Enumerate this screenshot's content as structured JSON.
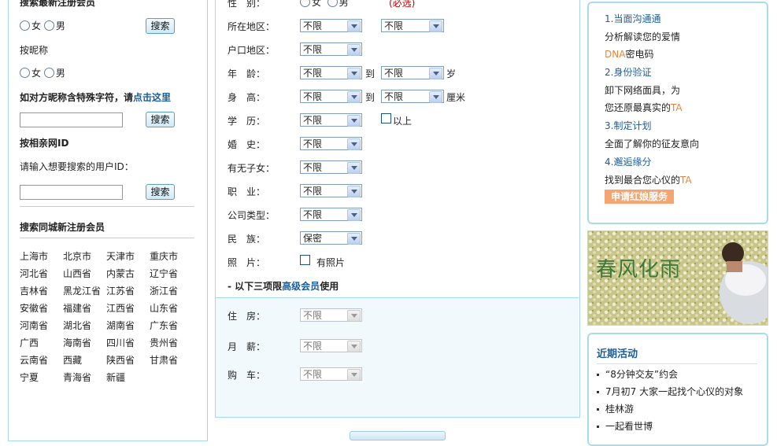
{
  "left": {
    "title_newest": "搜索最新注册会员",
    "female": "女",
    "male": "男",
    "search_btn": "搜索",
    "by_nickname": "按昵称",
    "special_prefix": "如对方昵称含特殊字符，请",
    "special_link": "点击这里",
    "by_id_title": "按相亲网ID",
    "id_prompt": "请输入想要搜索的用户ID：",
    "city_title": "搜索同城新注册会员",
    "cities": [
      "上海市",
      "北京市",
      "天津市",
      "重庆市",
      "河北省",
      "山西省",
      "内蒙古",
      "辽宁省",
      "吉林省",
      "黑龙江省",
      "江苏省",
      "浙江省",
      "安徽省",
      "福建省",
      "江西省",
      "山东省",
      "河南省",
      "湖北省",
      "湖南省",
      "广东省",
      "广西",
      "海南省",
      "四川省",
      "贵州省",
      "云南省",
      "西藏",
      "陕西省",
      "甘肃省",
      "宁夏",
      "青海省",
      "新疆"
    ]
  },
  "form": {
    "gender_label": "性　别：",
    "female": "女",
    "male": "男",
    "required": "(必选)",
    "region_label": "所在地区：",
    "hukou_label": "户口地区：",
    "age_label": "年　龄：",
    "height_label": "身　高：",
    "edu_label": "学　历：",
    "marriage_label": "婚　史：",
    "children_label": "有无子女：",
    "job_label": "职　业：",
    "company_label": "公司类型：",
    "nation_label": "民　族：",
    "photo_label": "照　片：",
    "to": "到",
    "age_unit": "岁",
    "height_unit": "厘米",
    "above": "以上",
    "has_photo": "有照片",
    "unlimited": "不限",
    "secret": "保密",
    "premium_prefix": "- 以下三项限",
    "premium_link": "高级会员",
    "premium_suffix": "使用",
    "housing_label": "住　房：",
    "salary_label": "月　薪：",
    "car_label": "购　车："
  },
  "right": {
    "step1": "1.当面沟通通",
    "step1_desc": "分析解读您的爱情",
    "step1_dna": "DNA",
    "step1_dna_suffix": "密电码",
    "step2": "2.身份验证",
    "step2_desc1": "卸下网络面具，为",
    "step2_desc2": "您还原最真实的",
    "ta": "TA",
    "step3": "3.制定计划",
    "step3_desc": "全面了解你的征友意向",
    "step4": "4.邂逅缘分",
    "step4_desc": "找到最合您心仪的",
    "apply": "申请红娘服务",
    "banner_text": "春风化雨",
    "events_title": "近期活动",
    "events": [
      "“8分钟交友”约会",
      "7月初7 大家一起找个心仪的对象",
      "桂林游",
      "一起看世博"
    ]
  }
}
